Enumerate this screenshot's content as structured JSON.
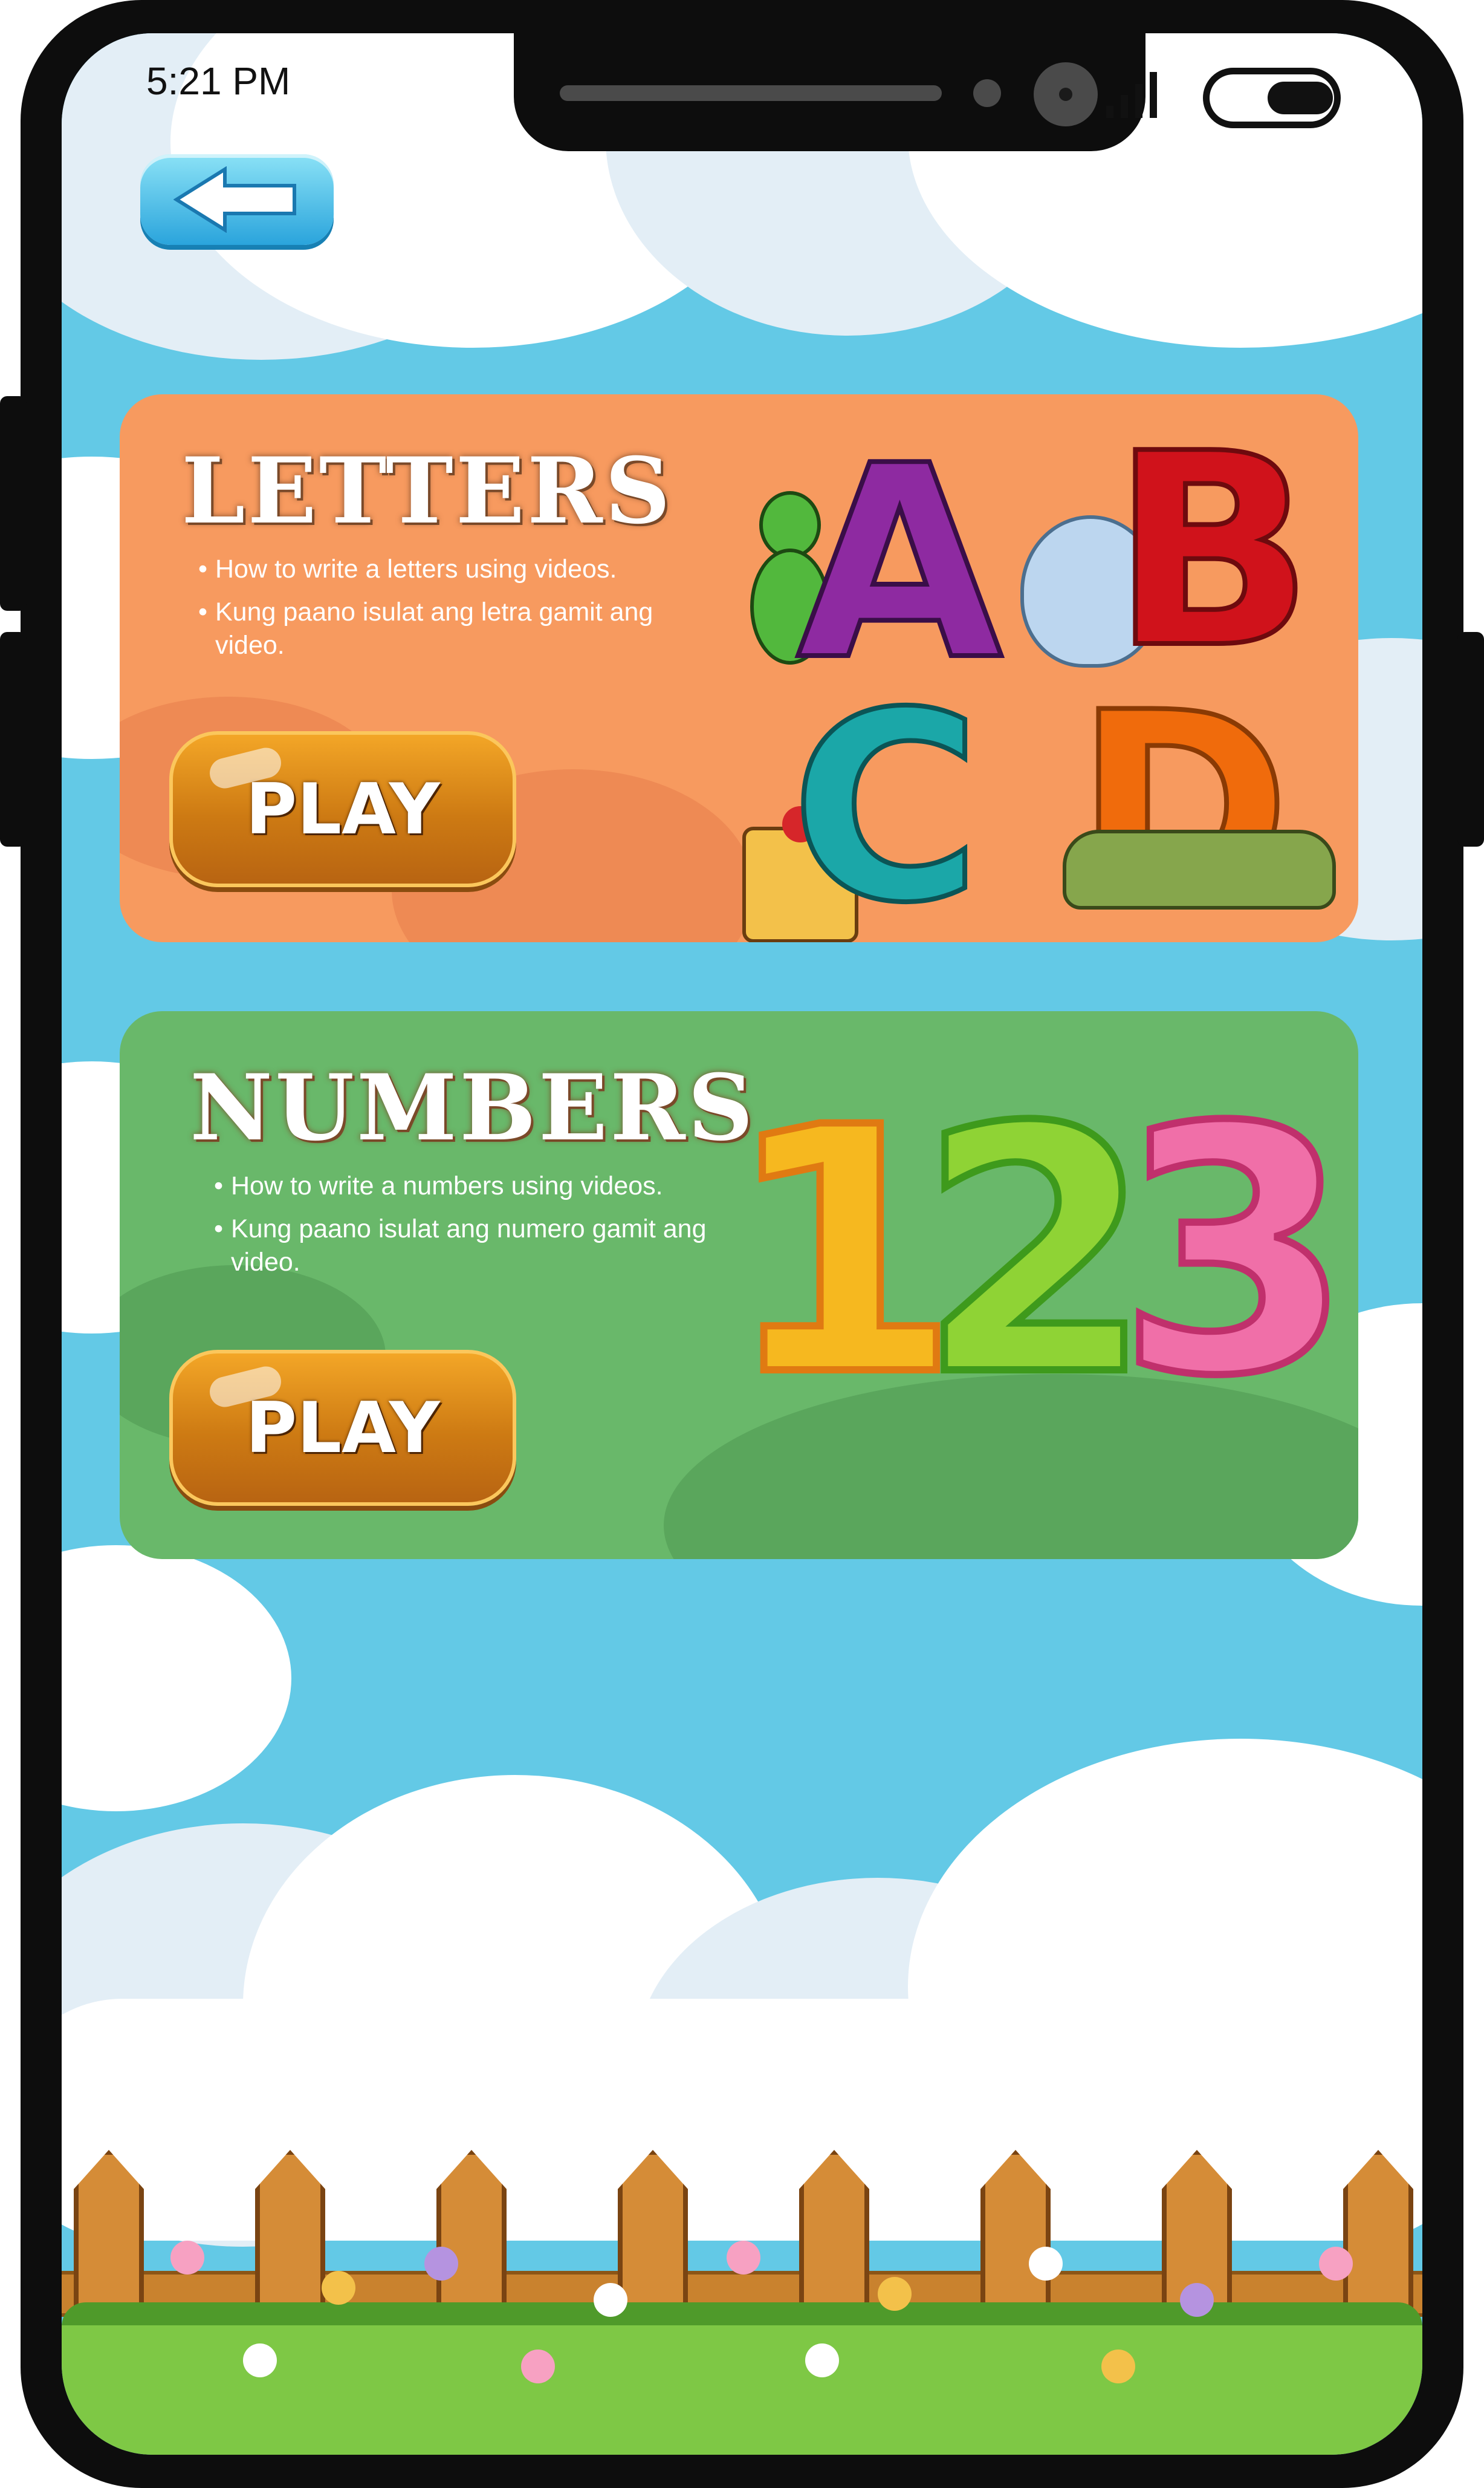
{
  "status_bar": {
    "time": "5:21 PM"
  },
  "cards": {
    "letters": {
      "title": "LETTERS",
      "bullets": [
        "How to write a letters using videos.",
        "Kung paano isulat ang letra gamit ang video."
      ],
      "play_label": "PLAY",
      "letters": [
        "A",
        "B",
        "C",
        "D"
      ]
    },
    "numbers": {
      "title": "NUMBERS",
      "bullets": [
        "How to write a numbers using videos.",
        "Kung paano isulat ang numero gamit ang video."
      ],
      "play_label": "PLAY",
      "digits": [
        "1",
        "2",
        "3"
      ]
    }
  },
  "colors": {
    "sky": "#63c9e6",
    "letters_card": "#f79a5f",
    "numbers_card": "#69b86a",
    "play_button": "#d98518",
    "back_button": "#2aa4dc"
  },
  "icons": [
    "back-arrow-icon",
    "signal-icon",
    "battery-icon"
  ]
}
